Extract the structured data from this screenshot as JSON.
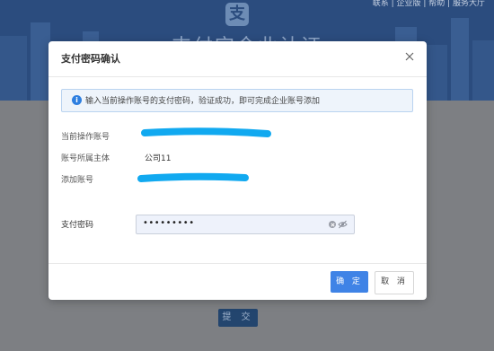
{
  "background": {
    "toplinks": "联系 | 企业版 | 帮助 | 服务大厅",
    "logo_glyph": "支",
    "title": "支付宝企业认证",
    "submit_label": "提 交"
  },
  "modal": {
    "title": "支付密码确认",
    "info_text": "输入当前操作账号的支付密码，验证成功，即可完成企业账号添加",
    "fields": [
      {
        "label": "当前操作账号",
        "value": ""
      },
      {
        "label": "账号所属主体",
        "value": "公司11"
      },
      {
        "label": "添加账号",
        "value": ""
      }
    ],
    "password": {
      "label": "支付密码",
      "value": "•••••••••"
    },
    "ok_label": "确 定",
    "cancel_label": "取 消"
  },
  "colors": {
    "primary": "#3f83e6",
    "info_bg": "#eef4fb",
    "redaction": "#11a9f0"
  }
}
